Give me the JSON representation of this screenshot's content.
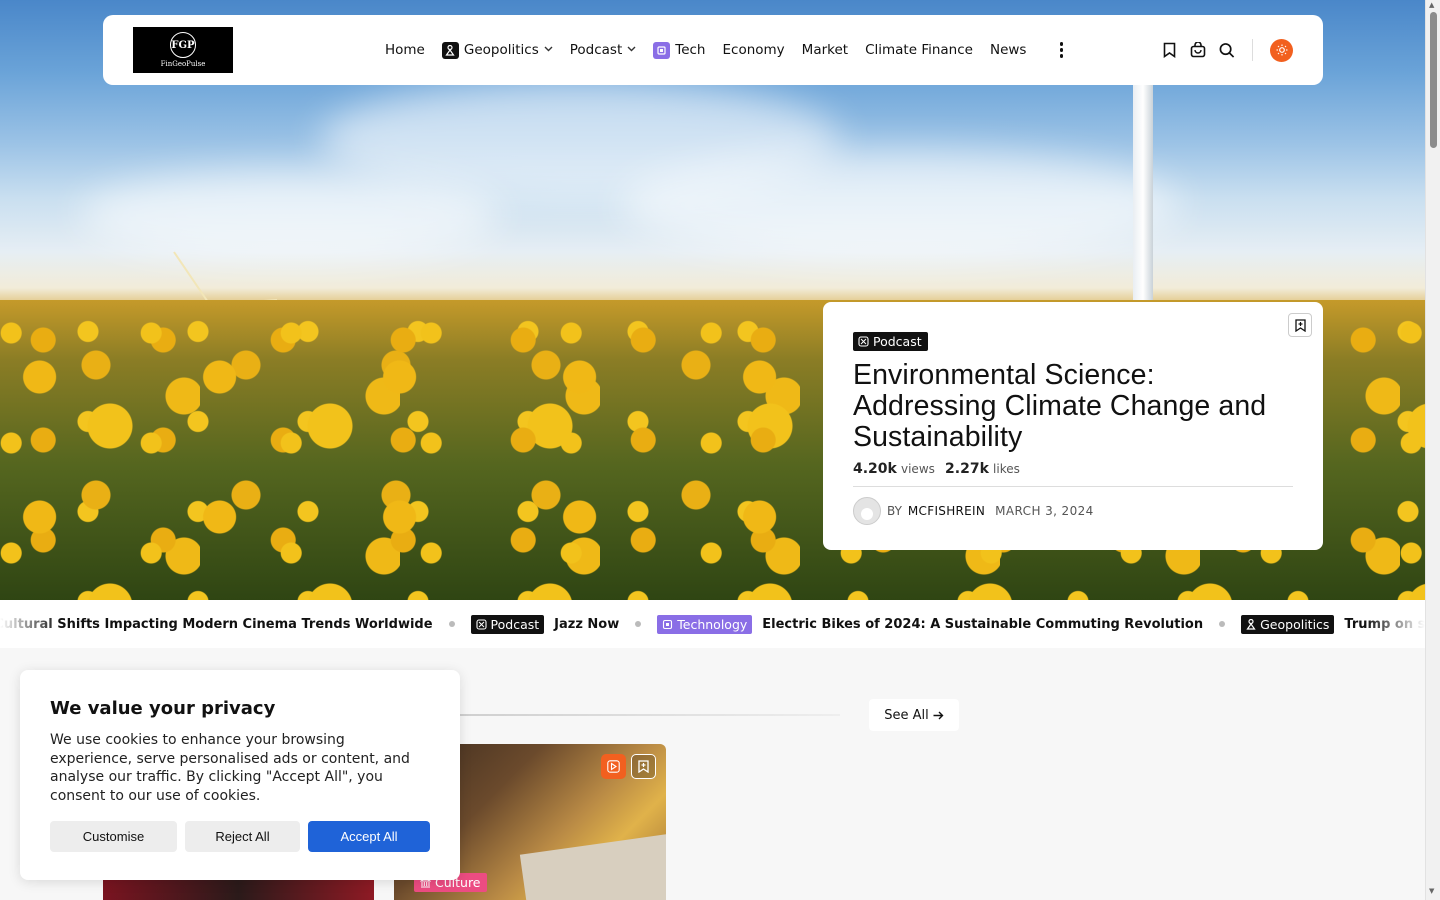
{
  "brand": {
    "logo_mark": "FGP",
    "logo_name": "FinGeoPulse"
  },
  "nav": {
    "items": [
      {
        "label": "Home"
      },
      {
        "label": "Geopolitics",
        "icon": "figure-icon",
        "dropdown": true
      },
      {
        "label": "Podcast",
        "dropdown": true
      },
      {
        "label": "Tech",
        "icon": "chip-icon"
      },
      {
        "label": "Economy"
      },
      {
        "label": "Market"
      },
      {
        "label": "Climate Finance"
      },
      {
        "label": "News"
      }
    ]
  },
  "feature": {
    "category": "Podcast",
    "title": "Environmental Science: Addressing Climate Change and Sustainability",
    "views_value": "4.20k",
    "views_label": "views",
    "likes_value": "2.27k",
    "likes_label": "likes",
    "by_label": "BY",
    "author": "MCFISHREIN",
    "date": "MARCH 3, 2024"
  },
  "ticker": {
    "items": [
      {
        "text": "ing the Cultural Shifts Impacting Modern Cinema Trends Worldwide"
      },
      {
        "tag": "Podcast",
        "tag_style": "black",
        "text": "Jazz Now"
      },
      {
        "tag": "Technology",
        "tag_style": "purple",
        "text": "Electric Bikes of 2024: A Sustainable Commuting Revolution"
      },
      {
        "tag": "Geopolitics",
        "tag_style": "black",
        "text": "Trump on strike of Iranian"
      }
    ]
  },
  "section": {
    "see_all": "See All"
  },
  "post": {
    "category": "Culture"
  },
  "cookie": {
    "title": "We value your privacy",
    "text": "We use cookies to enhance your browsing experience, serve personalised ads or content, and analyse our traffic. By clicking \"Accept All\", you consent to our use of cookies.",
    "customise": "Customise",
    "reject": "Reject All",
    "accept": "Accept All"
  },
  "colors": {
    "accent": "#f2601f",
    "primary_button": "#1f63d8",
    "tech_tag": "#8a6ee6",
    "culture_tag": "#ec4c82"
  }
}
